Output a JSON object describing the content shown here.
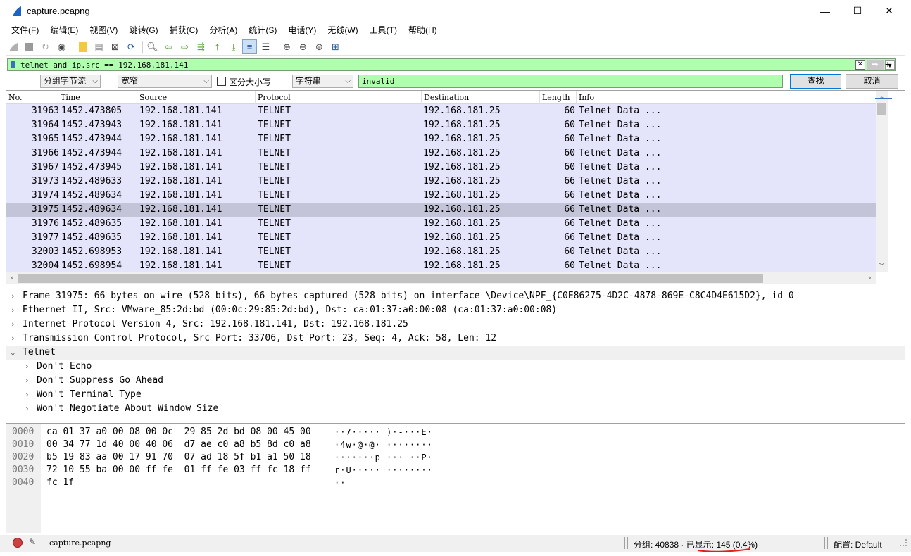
{
  "window": {
    "title": "capture.pcapng",
    "minimize": "—",
    "maximize": "☐",
    "close": "✕"
  },
  "menu": [
    "文件(F)",
    "编辑(E)",
    "视图(V)",
    "跳转(G)",
    "捕获(C)",
    "分析(A)",
    "统计(S)",
    "电话(Y)",
    "无线(W)",
    "工具(T)",
    "帮助(H)"
  ],
  "filter": {
    "value": "telnet and ip.src == 192.168.181.141",
    "plus": "+"
  },
  "find": {
    "search_in": "分组字节流",
    "char_width": "宽窄",
    "case_label": "区分大小写",
    "search_type": "字符串",
    "query": "invalid",
    "find_button": "查找",
    "cancel_button": "取消"
  },
  "packet_list": {
    "columns": [
      "No.",
      "Time",
      "Source",
      "Protocol",
      "Destination",
      "Length",
      "Info"
    ],
    "rows": [
      {
        "no": "31963",
        "time": "1452.473805",
        "src": "192.168.181.141",
        "proto": "TELNET",
        "dst": "192.168.181.25",
        "len": "60",
        "info": "Telnet Data ..."
      },
      {
        "no": "31964",
        "time": "1452.473943",
        "src": "192.168.181.141",
        "proto": "TELNET",
        "dst": "192.168.181.25",
        "len": "60",
        "info": "Telnet Data ..."
      },
      {
        "no": "31965",
        "time": "1452.473944",
        "src": "192.168.181.141",
        "proto": "TELNET",
        "dst": "192.168.181.25",
        "len": "60",
        "info": "Telnet Data ..."
      },
      {
        "no": "31966",
        "time": "1452.473944",
        "src": "192.168.181.141",
        "proto": "TELNET",
        "dst": "192.168.181.25",
        "len": "60",
        "info": "Telnet Data ..."
      },
      {
        "no": "31967",
        "time": "1452.473945",
        "src": "192.168.181.141",
        "proto": "TELNET",
        "dst": "192.168.181.25",
        "len": "60",
        "info": "Telnet Data ..."
      },
      {
        "no": "31973",
        "time": "1452.489633",
        "src": "192.168.181.141",
        "proto": "TELNET",
        "dst": "192.168.181.25",
        "len": "66",
        "info": "Telnet Data ..."
      },
      {
        "no": "31974",
        "time": "1452.489634",
        "src": "192.168.181.141",
        "proto": "TELNET",
        "dst": "192.168.181.25",
        "len": "66",
        "info": "Telnet Data ..."
      },
      {
        "no": "31975",
        "time": "1452.489634",
        "src": "192.168.181.141",
        "proto": "TELNET",
        "dst": "192.168.181.25",
        "len": "66",
        "info": "Telnet Data ...",
        "selected": true
      },
      {
        "no": "31976",
        "time": "1452.489635",
        "src": "192.168.181.141",
        "proto": "TELNET",
        "dst": "192.168.181.25",
        "len": "66",
        "info": "Telnet Data ..."
      },
      {
        "no": "31977",
        "time": "1452.489635",
        "src": "192.168.181.141",
        "proto": "TELNET",
        "dst": "192.168.181.25",
        "len": "66",
        "info": "Telnet Data ..."
      },
      {
        "no": "32003",
        "time": "1452.698953",
        "src": "192.168.181.141",
        "proto": "TELNET",
        "dst": "192.168.181.25",
        "len": "60",
        "info": "Telnet Data ..."
      },
      {
        "no": "32004",
        "time": "1452.698954",
        "src": "192.168.181.141",
        "proto": "TELNET",
        "dst": "192.168.181.25",
        "len": "60",
        "info": "Telnet Data ..."
      }
    ]
  },
  "details": [
    {
      "text": "Frame 31975: 66 bytes on wire (528 bits), 66 bytes captured (528 bits) on interface \\Device\\NPF_{C0E86275-4D2C-4878-869E-C8C4D4E615D2}, id 0",
      "expanded": false,
      "level": 0
    },
    {
      "text": "Ethernet II, Src: VMware_85:2d:bd (00:0c:29:85:2d:bd), Dst: ca:01:37:a0:00:08 (ca:01:37:a0:00:08)",
      "expanded": false,
      "level": 0
    },
    {
      "text": "Internet Protocol Version 4, Src: 192.168.181.141, Dst: 192.168.181.25",
      "expanded": false,
      "level": 0
    },
    {
      "text": "Transmission Control Protocol, Src Port: 33706, Dst Port: 23, Seq: 4, Ack: 58, Len: 12",
      "expanded": false,
      "level": 0
    },
    {
      "text": "Telnet",
      "expanded": true,
      "level": 0
    },
    {
      "text": "Don't Echo",
      "expanded": false,
      "level": 1
    },
    {
      "text": "Don't Suppress Go Ahead",
      "expanded": false,
      "level": 1
    },
    {
      "text": "Won't Terminal Type",
      "expanded": false,
      "level": 1
    },
    {
      "text": "Won't Negotiate About Window Size",
      "expanded": false,
      "level": 1
    }
  ],
  "bytes": [
    {
      "offset": "0000",
      "hex": "ca 01 37 a0 00 08 00 0c  29 85 2d bd 08 00 45 00",
      "ascii": "··7····· )·-···E·"
    },
    {
      "offset": "0010",
      "hex": "00 34 77 1d 40 00 40 06  d7 ae c0 a8 b5 8d c0 a8",
      "ascii": "·4w·@·@· ········"
    },
    {
      "offset": "0020",
      "hex": "b5 19 83 aa 00 17 91 70  07 ad 18 5f b1 a1 50 18",
      "ascii": "·······p ···_··P·"
    },
    {
      "offset": "0030",
      "hex": "72 10 55 ba 00 00 ff fe  01 ff fe 03 ff fc 18 ff",
      "ascii": "r·U····· ········"
    },
    {
      "offset": "0040",
      "hex": "fc 1f",
      "ascii": "··"
    }
  ],
  "status": {
    "file": "capture.pcapng",
    "stats": "分组: 40838 · 已显示: 145 (0.4%)",
    "profile": "配置: Default"
  },
  "colors": {
    "filter_bg": "#afffaf",
    "row_bg": "#e4e4fb",
    "row_selected": "#c4c4d8"
  }
}
